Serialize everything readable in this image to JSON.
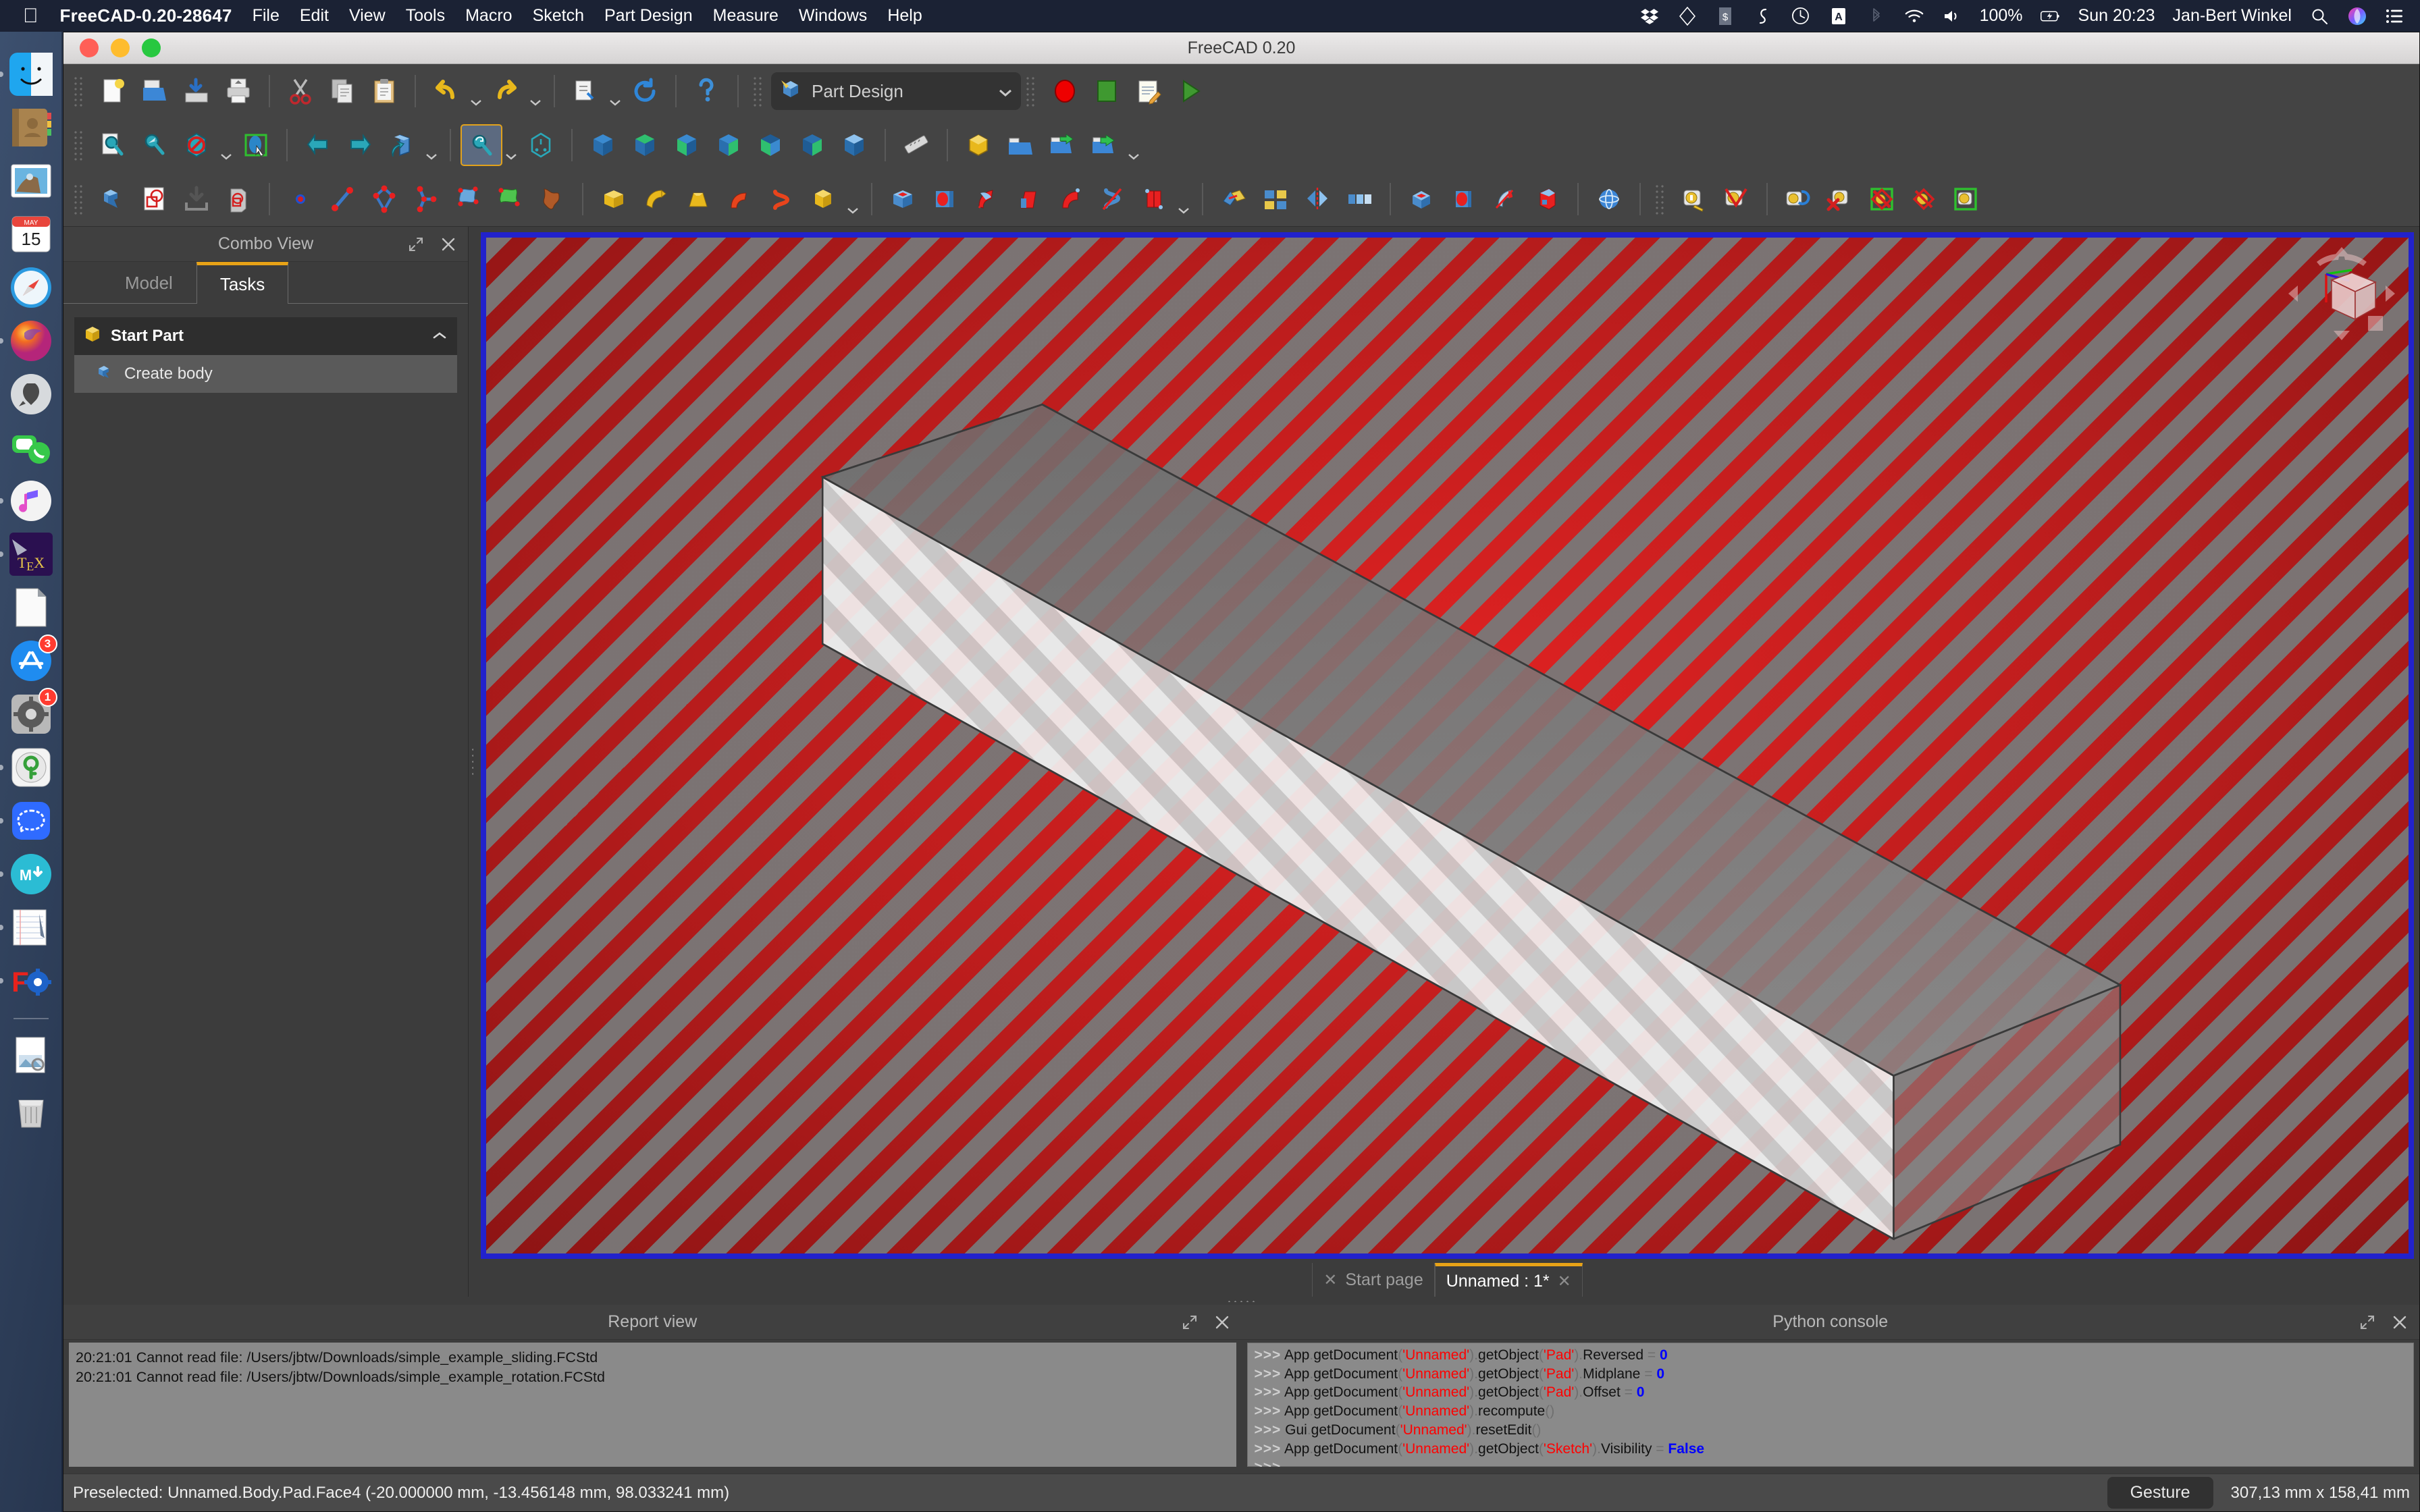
{
  "menubar": {
    "apple_icon": "apple-icon",
    "app_title": "FreeCAD-0.20-28647",
    "items": [
      "File",
      "Edit",
      "View",
      "Tools",
      "Macro",
      "Sketch",
      "Part Design",
      "Measure",
      "Windows",
      "Help"
    ],
    "status_icons": [
      "dropbox-icon",
      "diamond-icon",
      "dollar-script-icon",
      "sync-icon",
      "time-machine-icon",
      "input-source-a-icon",
      "bluetooth-icon",
      "wifi-icon",
      "volume-icon"
    ],
    "battery_percent": "100%",
    "battery_icon": "battery-charging-icon",
    "clock": "Sun 20:23",
    "user": "Jan-Bert Winkel",
    "search_icon": "spotlight-search-icon",
    "siri_icon": "siri-icon",
    "control_center_icon": "control-center-icon"
  },
  "dock": {
    "items": [
      {
        "name": "finder",
        "running": true
      },
      {
        "name": "contacts",
        "running": false
      },
      {
        "name": "mail",
        "running": false
      },
      {
        "name": "calendar",
        "running": false,
        "badge_month": "MAY",
        "badge_day": "15"
      },
      {
        "name": "safari",
        "running": false
      },
      {
        "name": "firefox",
        "running": true
      },
      {
        "name": "launchpad",
        "running": false
      },
      {
        "name": "facetime",
        "running": false
      },
      {
        "name": "music",
        "running": true
      },
      {
        "name": "tex",
        "running": true
      },
      {
        "name": "preview-document",
        "running": false
      },
      {
        "name": "app-store",
        "running": false,
        "badge": "3"
      },
      {
        "name": "system-preferences",
        "running": false,
        "badge": "1"
      },
      {
        "name": "keychain",
        "running": true
      },
      {
        "name": "signal",
        "running": true
      },
      {
        "name": "macdown",
        "running": true
      },
      {
        "name": "notes",
        "running": true
      },
      {
        "name": "freecad",
        "running": true
      },
      {
        "name": "downloads-stack",
        "running": false
      },
      {
        "name": "trash",
        "running": false
      }
    ]
  },
  "window": {
    "title": "FreeCAD 0.20",
    "traffic_lights": [
      "close",
      "minimize",
      "zoom"
    ]
  },
  "toolbars": {
    "row1": [
      {
        "name": "new-file-icon"
      },
      {
        "name": "open-file-icon"
      },
      {
        "name": "save-file-icon"
      },
      {
        "name": "print-icon"
      },
      {
        "sep": true
      },
      {
        "name": "cut-icon"
      },
      {
        "name": "copy-icon"
      },
      {
        "name": "paste-icon"
      },
      {
        "sep": true
      },
      {
        "name": "undo-icon",
        "caret": true
      },
      {
        "name": "redo-icon",
        "caret": true
      },
      {
        "sep": true
      },
      {
        "name": "refine-shape-icon",
        "caret": true
      },
      {
        "name": "refresh-icon"
      },
      {
        "sep": true
      },
      {
        "name": "whats-this-icon"
      }
    ],
    "workbench_selector": {
      "label": "Part Design",
      "icon": "part-design-icon",
      "chevron": "chevron-down-icon"
    },
    "macro_buttons": [
      {
        "name": "macro-record-icon"
      },
      {
        "name": "macro-stop-icon"
      },
      {
        "name": "macro-edit-icon"
      },
      {
        "name": "macro-execute-icon"
      }
    ],
    "row2": [
      {
        "name": "fit-all-icon"
      },
      {
        "name": "fit-selection-icon"
      },
      {
        "name": "draw-style-icon",
        "caret": true
      },
      {
        "name": "select-box-icon"
      },
      {
        "sep": true
      },
      {
        "name": "std-view-back-icon"
      },
      {
        "name": "std-view-forward-icon"
      },
      {
        "name": "axonometric-icon",
        "caret": true
      },
      {
        "sep": true
      },
      {
        "name": "zoom-rotate-icon",
        "caret": true,
        "active": true
      },
      {
        "name": "view-front-icon"
      },
      {
        "sep": true
      },
      {
        "name": "view-isometric-icon"
      },
      {
        "name": "view-top-icon"
      },
      {
        "name": "view-right-icon"
      },
      {
        "name": "view-rear-icon"
      },
      {
        "name": "view-bottom-icon"
      },
      {
        "name": "view-left-icon"
      },
      {
        "name": "view-dimetric-icon"
      },
      {
        "sep": true
      },
      {
        "name": "measure-distance-icon"
      },
      {
        "sep": true
      },
      {
        "name": "appearance-icon"
      },
      {
        "name": "group-icon"
      },
      {
        "name": "link-make-icon"
      },
      {
        "name": "link-go-icon",
        "caret": true
      }
    ],
    "row3": [
      {
        "name": "create-body-icon"
      },
      {
        "name": "create-sketch-icon"
      },
      {
        "name": "attach-sketch-icon"
      },
      {
        "name": "validate-sketch-icon"
      },
      {
        "sep": true
      },
      {
        "name": "create-point-icon"
      },
      {
        "name": "create-line-icon"
      },
      {
        "name": "create-polyline-icon"
      },
      {
        "name": "create-datum-icon"
      },
      {
        "name": "create-shape-binder-icon"
      },
      {
        "name": "create-sub-object-binder-icon"
      },
      {
        "name": "create-clone-icon"
      },
      {
        "sep": true
      },
      {
        "name": "pad-icon"
      },
      {
        "name": "revolution-icon"
      },
      {
        "name": "additive-loft-icon"
      },
      {
        "name": "additive-pipe-icon"
      },
      {
        "name": "additive-helix-icon"
      },
      {
        "name": "additive-box-icon",
        "caret": true
      },
      {
        "sep": true
      },
      {
        "name": "pocket-icon"
      },
      {
        "name": "hole-icon"
      },
      {
        "name": "groove-icon"
      },
      {
        "name": "subtractive-loft-icon"
      },
      {
        "name": "subtractive-pipe-icon"
      },
      {
        "name": "subtractive-helix-icon"
      },
      {
        "name": "subtractive-box-icon",
        "caret": true
      },
      {
        "sep": true
      },
      {
        "name": "boolean-icon"
      },
      {
        "name": "multi-transform-icon"
      },
      {
        "name": "mirrored-icon"
      },
      {
        "name": "linear-pattern-icon"
      },
      {
        "sep": true
      },
      {
        "name": "fillet-icon"
      },
      {
        "name": "chamfer-icon"
      },
      {
        "name": "draft-icon"
      },
      {
        "name": "thickness-icon"
      },
      {
        "sep": true
      },
      {
        "name": "sphere-icon"
      },
      {
        "sep": true
      },
      {
        "name": "measure-length-icon"
      },
      {
        "name": "measure-angle-icon"
      },
      {
        "sep": true
      },
      {
        "name": "measure-refresh-icon"
      },
      {
        "name": "measure-clear-icon"
      },
      {
        "name": "measure-toggle-3d-icon"
      },
      {
        "name": "measure-toggle-delta-icon"
      },
      {
        "name": "measure-toggle-all-icon"
      }
    ]
  },
  "combo_view": {
    "title": "Combo View",
    "expand_icon": "expand-icon",
    "close_icon": "close-icon",
    "tabs": [
      {
        "label": "Model",
        "active": false
      },
      {
        "label": "Tasks",
        "active": true
      }
    ],
    "task_group": {
      "icon": "part-box-icon",
      "title": "Start Part",
      "collapse_icon": "chevron-up-icon",
      "items": [
        {
          "icon": "create-body-icon",
          "label": "Create body"
        }
      ]
    }
  },
  "view3d": {
    "border_color": "#2222cc",
    "background_color": "#c81e1e",
    "navcube": {
      "name": "navigation-cube",
      "axes": [
        "x-axis-red",
        "y-axis-green",
        "z-axis-blue"
      ]
    },
    "model": "padded rectangular box (Unnamed.Body.Pad)"
  },
  "doc_tabs": [
    {
      "label": "Start page",
      "active": false,
      "close_icon": "close-icon"
    },
    {
      "label": "Unnamed : 1*",
      "active": true,
      "close_icon": "close-icon"
    }
  ],
  "report_view": {
    "title": "Report view",
    "expand_icon": "expand-icon",
    "close_icon": "close-icon",
    "lines": [
      {
        "time": "20:21:01",
        "text": "Cannot read file:  /Users/jbtw/Downloads/simple_example_sliding.FCStd"
      },
      {
        "time": "20:21:01",
        "text": "Cannot read file:  /Users/jbtw/Downloads/simple_example_rotation.FCStd"
      }
    ]
  },
  "python_console": {
    "title": "Python console",
    "expand_icon": "expand-icon",
    "close_icon": "close-icon",
    "lines": [
      [
        {
          "t": "prompt",
          "v": ">>>"
        },
        {
          "t": "plain",
          "v": " App"
        },
        {
          "t": "dim",
          "v": "."
        },
        {
          "t": "plain",
          "v": "getDocument"
        },
        {
          "t": "dim",
          "v": "("
        },
        {
          "t": "str",
          "v": "'Unnamed'"
        },
        {
          "t": "dim",
          "v": ")"
        },
        {
          "t": "dim",
          "v": "."
        },
        {
          "t": "plain",
          "v": "getObject"
        },
        {
          "t": "dim",
          "v": "("
        },
        {
          "t": "str",
          "v": "'Pad'"
        },
        {
          "t": "dim",
          "v": ")"
        },
        {
          "t": "dim",
          "v": "."
        },
        {
          "t": "plain",
          "v": "Reversed "
        },
        {
          "t": "dim",
          "v": "= "
        },
        {
          "t": "num",
          "v": "0"
        }
      ],
      [
        {
          "t": "prompt",
          "v": ">>>"
        },
        {
          "t": "plain",
          "v": " App"
        },
        {
          "t": "dim",
          "v": "."
        },
        {
          "t": "plain",
          "v": "getDocument"
        },
        {
          "t": "dim",
          "v": "("
        },
        {
          "t": "str",
          "v": "'Unnamed'"
        },
        {
          "t": "dim",
          "v": ")"
        },
        {
          "t": "dim",
          "v": "."
        },
        {
          "t": "plain",
          "v": "getObject"
        },
        {
          "t": "dim",
          "v": "("
        },
        {
          "t": "str",
          "v": "'Pad'"
        },
        {
          "t": "dim",
          "v": ")"
        },
        {
          "t": "dim",
          "v": "."
        },
        {
          "t": "plain",
          "v": "Midplane "
        },
        {
          "t": "dim",
          "v": "= "
        },
        {
          "t": "num",
          "v": "0"
        }
      ],
      [
        {
          "t": "prompt",
          "v": ">>>"
        },
        {
          "t": "plain",
          "v": " App"
        },
        {
          "t": "dim",
          "v": "."
        },
        {
          "t": "plain",
          "v": "getDocument"
        },
        {
          "t": "dim",
          "v": "("
        },
        {
          "t": "str",
          "v": "'Unnamed'"
        },
        {
          "t": "dim",
          "v": ")"
        },
        {
          "t": "dim",
          "v": "."
        },
        {
          "t": "plain",
          "v": "getObject"
        },
        {
          "t": "dim",
          "v": "("
        },
        {
          "t": "str",
          "v": "'Pad'"
        },
        {
          "t": "dim",
          "v": ")"
        },
        {
          "t": "dim",
          "v": "."
        },
        {
          "t": "plain",
          "v": "Offset "
        },
        {
          "t": "dim",
          "v": "= "
        },
        {
          "t": "num",
          "v": "0"
        }
      ],
      [
        {
          "t": "prompt",
          "v": ">>>"
        },
        {
          "t": "plain",
          "v": " App"
        },
        {
          "t": "dim",
          "v": "."
        },
        {
          "t": "plain",
          "v": "getDocument"
        },
        {
          "t": "dim",
          "v": "("
        },
        {
          "t": "str",
          "v": "'Unnamed'"
        },
        {
          "t": "dim",
          "v": ")"
        },
        {
          "t": "dim",
          "v": "."
        },
        {
          "t": "plain",
          "v": "recompute"
        },
        {
          "t": "dim",
          "v": "()"
        }
      ],
      [
        {
          "t": "prompt",
          "v": ">>>"
        },
        {
          "t": "plain",
          "v": " Gui"
        },
        {
          "t": "dim",
          "v": "."
        },
        {
          "t": "plain",
          "v": "getDocument"
        },
        {
          "t": "dim",
          "v": "("
        },
        {
          "t": "str",
          "v": "'Unnamed'"
        },
        {
          "t": "dim",
          "v": ")"
        },
        {
          "t": "dim",
          "v": "."
        },
        {
          "t": "plain",
          "v": "resetEdit"
        },
        {
          "t": "dim",
          "v": "()"
        }
      ],
      [
        {
          "t": "prompt",
          "v": ">>>"
        },
        {
          "t": "plain",
          "v": " App"
        },
        {
          "t": "dim",
          "v": "."
        },
        {
          "t": "plain",
          "v": "getDocument"
        },
        {
          "t": "dim",
          "v": "("
        },
        {
          "t": "str",
          "v": "'Unnamed'"
        },
        {
          "t": "dim",
          "v": ")"
        },
        {
          "t": "dim",
          "v": "."
        },
        {
          "t": "plain",
          "v": "getObject"
        },
        {
          "t": "dim",
          "v": "("
        },
        {
          "t": "str",
          "v": "'Sketch'"
        },
        {
          "t": "dim",
          "v": ")"
        },
        {
          "t": "dim",
          "v": "."
        },
        {
          "t": "plain",
          "v": "Visibility "
        },
        {
          "t": "dim",
          "v": "= "
        },
        {
          "t": "num",
          "v": "False"
        }
      ],
      [
        {
          "t": "prompt",
          "v": ">>>"
        }
      ]
    ]
  },
  "statusbar": {
    "message": "Preselected: Unnamed.Body.Pad.Face4 (-20.000000 mm, -13.456148 mm, 98.033241 mm)",
    "navigation_style": "Gesture",
    "navigation_icon": "gesture-icon",
    "dimensions": "307,13 mm x 158,41 mm"
  }
}
